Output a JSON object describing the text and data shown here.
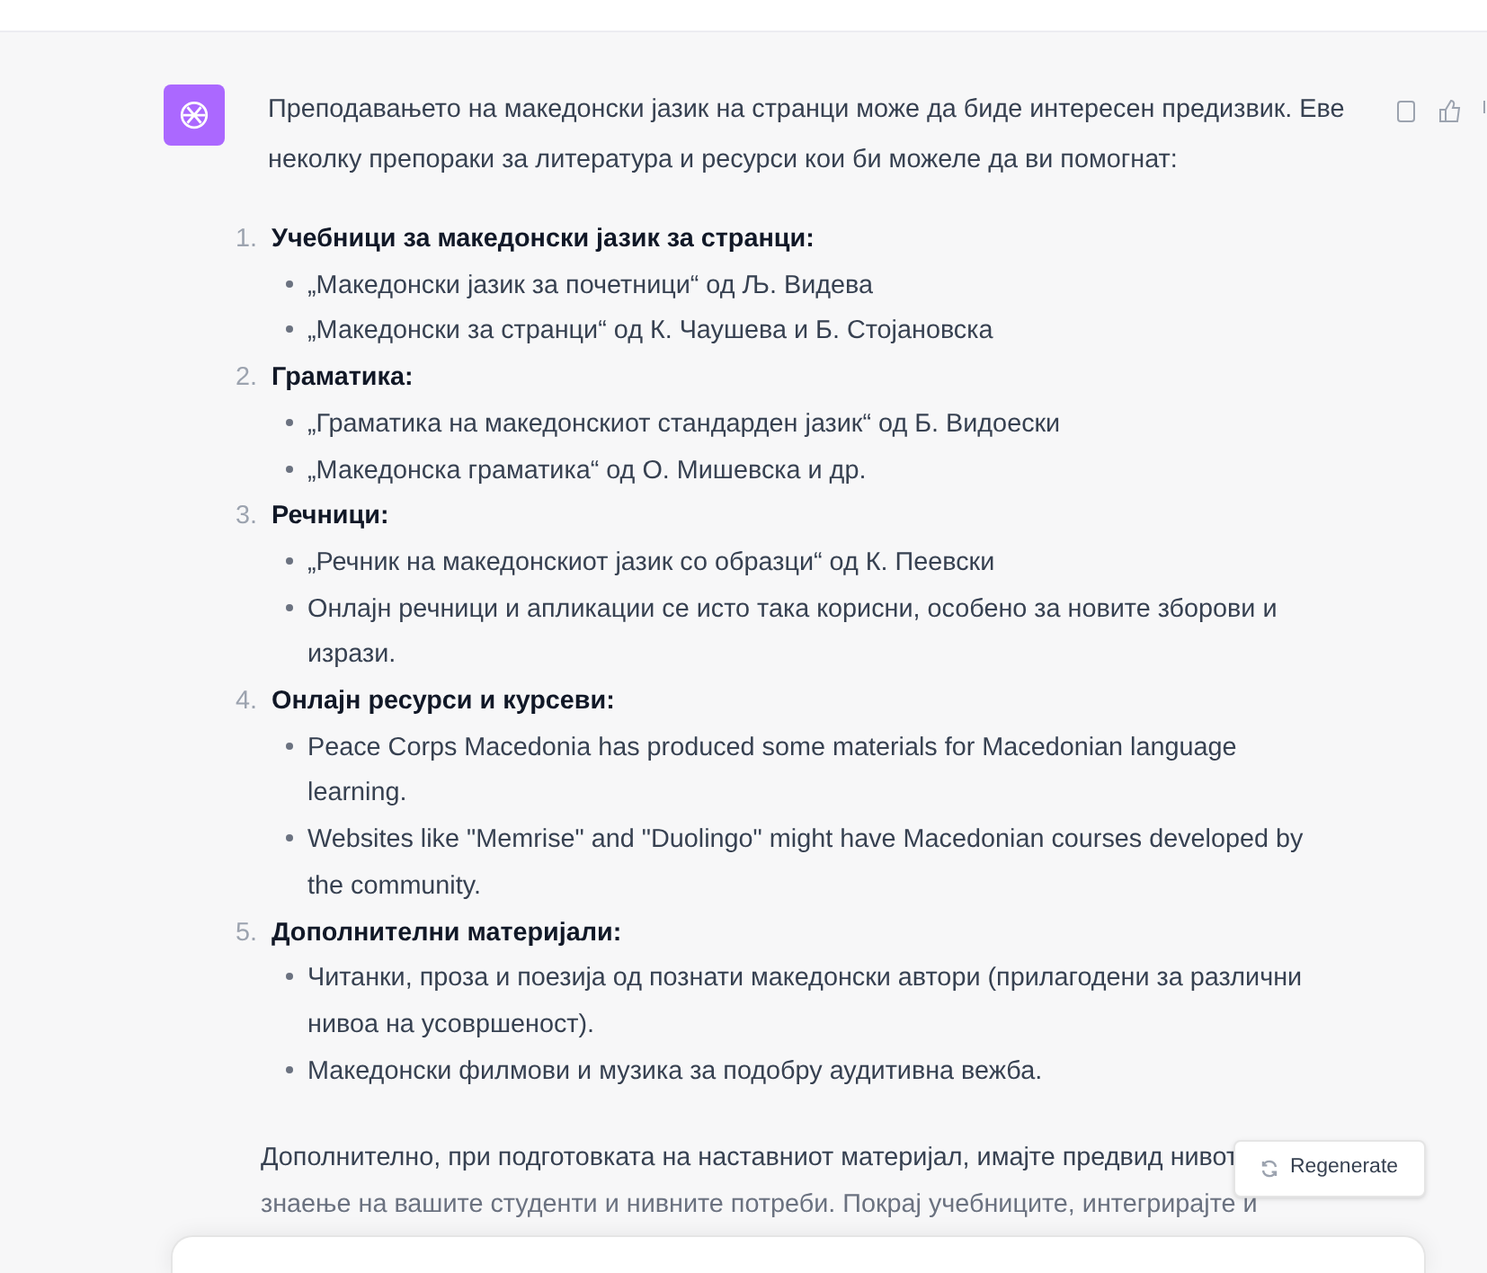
{
  "message": {
    "intro": "Преподавањето на македонски јазик на странци може да биде интересен предизвик. Еве неколку препораки за литература и ресурси кои би можеле да ви помогнат:",
    "sections": [
      {
        "number": "1.",
        "title": "Учебници за македонски јазик за странци:",
        "items": [
          "„Македонски јазик за почетници“ од Љ. Видева",
          "„Македонски за странци“ од К. Чаушева и Б. Стојановска"
        ]
      },
      {
        "number": "2.",
        "title": "Граматика:",
        "items": [
          "„Граматика на македонскиот стандарден јазик“ од Б. Видоески",
          "„Македонска граматика“ од О. Мишевска и др."
        ]
      },
      {
        "number": "3.",
        "title": "Речници:",
        "items": [
          "„Речник на македонскиот јазик со образци“ од К. Пеевски",
          "Онлајн речници и апликации се исто така корисни, особено за новите зборови и изрази."
        ]
      },
      {
        "number": "4.",
        "title": "Онлајн ресурси и курсеви:",
        "items": [
          "Peace Corps Macedonia has produced some materials for Macedonian language learning.",
          "Websites like \"Memrise\" and \"Duolingo\" might have Macedonian courses developed by the community."
        ]
      },
      {
        "number": "5.",
        "title": "Дополнителни материјали:",
        "items": [
          "Читанки, проза и поезија од познати македонски автори (прилагодени за различни нивоа на усовршеност).",
          "Македонски филмови и музика за подобру аудитивна вежба."
        ]
      }
    ],
    "closing_lines": [
      "Дополнително, при подготовката на наставниот материјал, имајте предвид нивот",
      "знаење на вашите студенти и нивните потреби. Покрај учебниците, интегрирајте и"
    ]
  },
  "regenerate_button": "Regenerate"
}
